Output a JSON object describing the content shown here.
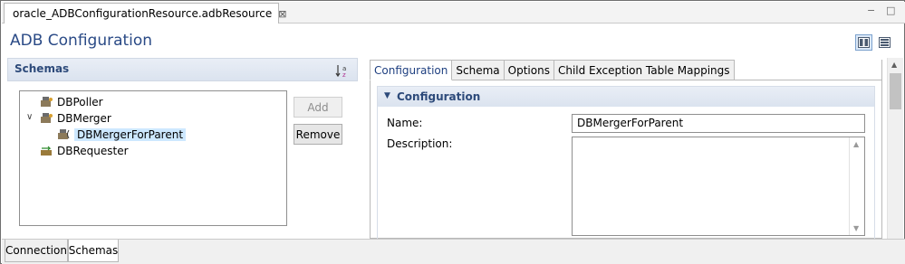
{
  "editor_tab": {
    "title": "oracle_ADBConfigurationResource.adbResource",
    "close_glyph": "⊠"
  },
  "window_controls": {
    "minimize": "−",
    "maximize": "□"
  },
  "page_title": "ADB Configuration",
  "schemas_section": {
    "title": "Schemas",
    "sort_icon": "sort-az-icon",
    "tree": [
      {
        "label": "DBPoller",
        "icon": "db-adapter-icon"
      },
      {
        "label": "DBMerger",
        "icon": "db-adapter-icon",
        "expanded": true
      },
      {
        "label": "DBMergerForParent",
        "icon": "db-adapter-child-icon",
        "selected": true
      },
      {
        "label": "DBRequester",
        "icon": "db-requester-icon"
      }
    ],
    "add_button": "Add",
    "remove_button": "Remove"
  },
  "tabs": [
    {
      "label": "Configuration",
      "active": true
    },
    {
      "label": "Schema"
    },
    {
      "label": "Options"
    },
    {
      "label": "Child Exception Table Mappings"
    }
  ],
  "configuration": {
    "section_title": "Configuration",
    "name_label": "Name:",
    "name_value": "DBMergerForParent",
    "description_label": "Description:",
    "description_value": ""
  },
  "bottom_tabs": [
    {
      "label": "Connection"
    },
    {
      "label": "Schemas",
      "active": true
    }
  ],
  "colors": {
    "title": "#2a4a86",
    "section_header": "#2d4a7a",
    "selection": "#cde8ff"
  }
}
